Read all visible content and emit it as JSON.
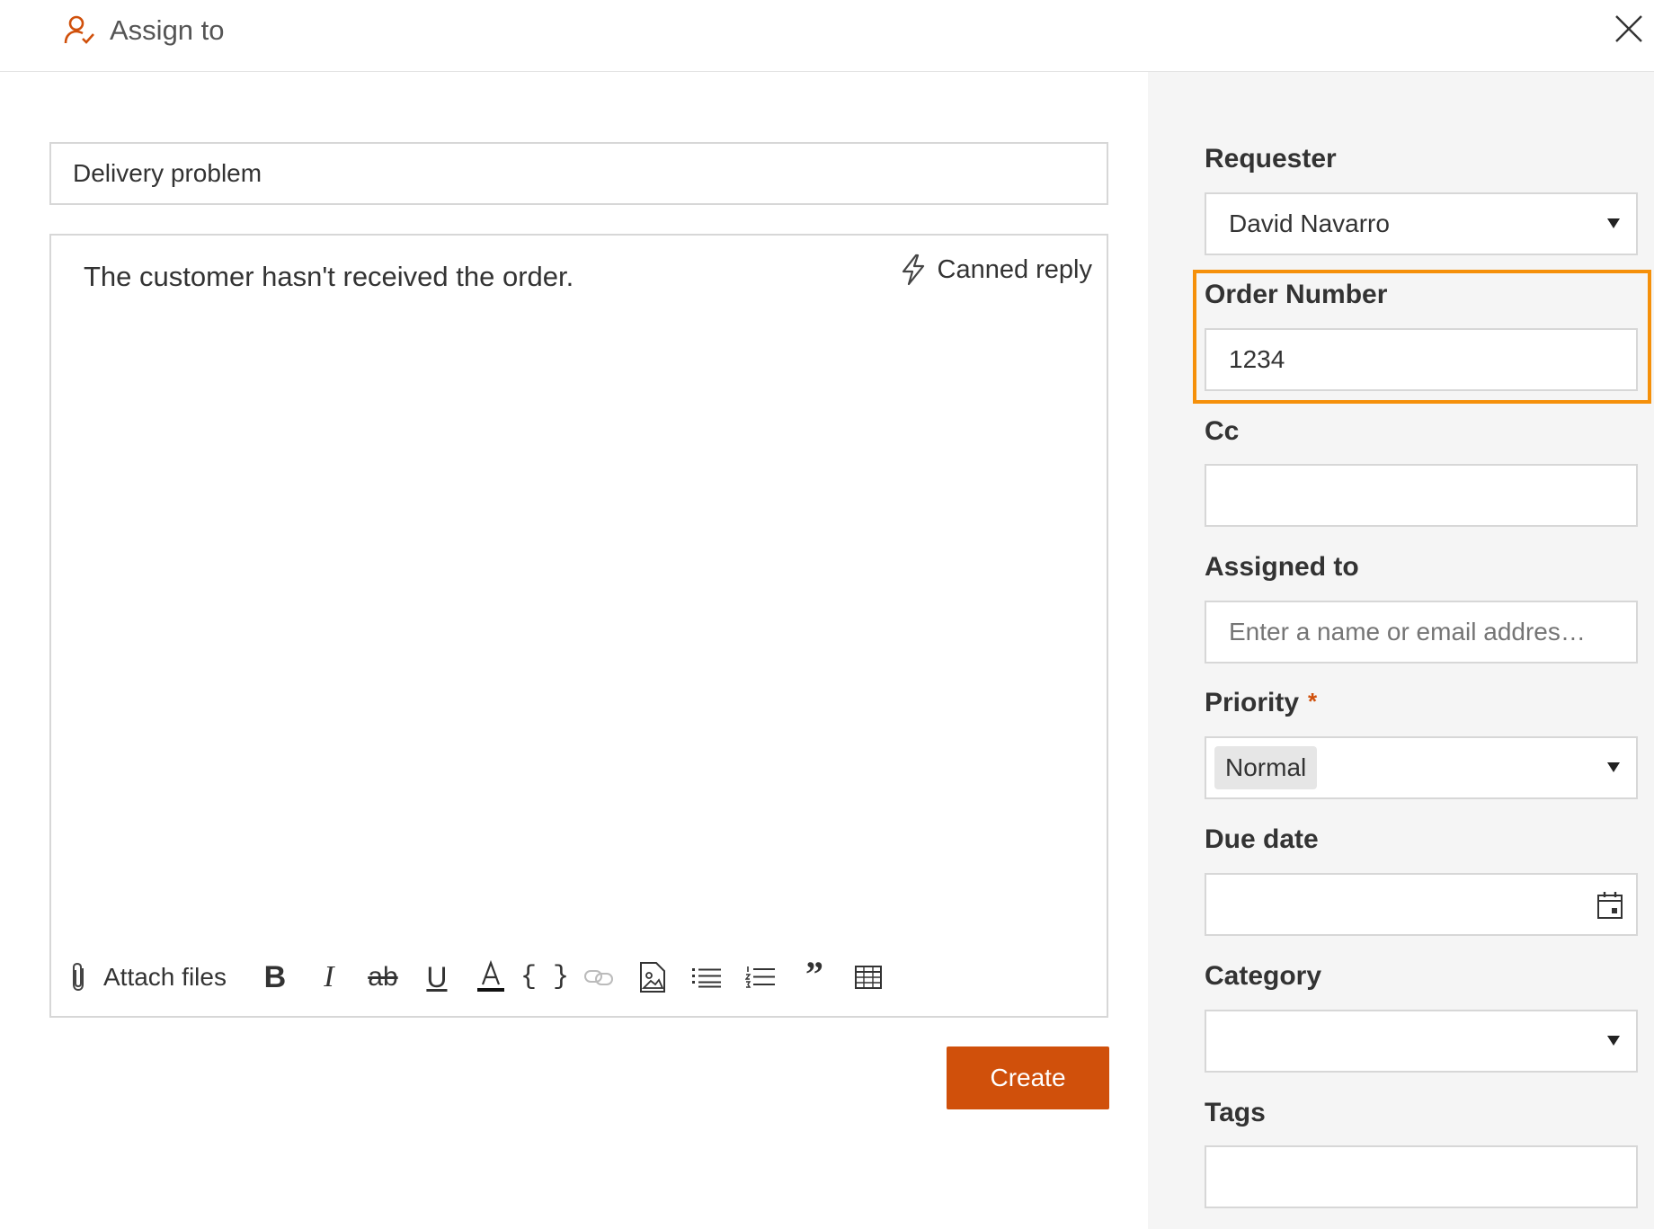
{
  "header": {
    "assign_label": "Assign to"
  },
  "ticket": {
    "subject": "Delivery problem",
    "body": "The customer hasn't received the order.",
    "canned_reply_label": "Canned reply"
  },
  "toolbar": {
    "attach_label": "Attach files",
    "bold_glyph": "B",
    "italic_glyph": "I",
    "strike_glyph": "ab",
    "underline_glyph": "U",
    "code_glyph": "{ }",
    "quote_glyph": "”"
  },
  "create_label": "Create",
  "sidebar": {
    "requester": {
      "label": "Requester",
      "value": "David Navarro"
    },
    "order_number": {
      "label": "Order Number",
      "value": "1234"
    },
    "cc": {
      "label": "Cc",
      "value": ""
    },
    "assigned_to": {
      "label": "Assigned to",
      "placeholder": "Enter a name or email addres…"
    },
    "priority": {
      "label": "Priority",
      "required_mark": "*",
      "value": "Normal"
    },
    "due_date": {
      "label": "Due date",
      "value": ""
    },
    "category": {
      "label": "Category",
      "value": ""
    },
    "tags": {
      "label": "Tags",
      "value": ""
    }
  },
  "colors": {
    "accent": "#d0500b",
    "highlight": "#f5900a",
    "sidebar_bg": "#f5f5f5",
    "border": "#d7d7d7"
  },
  "icons": {
    "assign": "user-check-icon",
    "close": "close-icon",
    "canned": "lightning-icon",
    "attach": "paperclip-icon",
    "text_color": "text-color-icon",
    "link": "link-icon",
    "image": "image-icon",
    "bullet_list": "bullet-list-icon",
    "numbered_list": "numbered-list-icon",
    "table": "table-icon",
    "dropdown": "chevron-down-icon",
    "calendar": "calendar-icon"
  }
}
